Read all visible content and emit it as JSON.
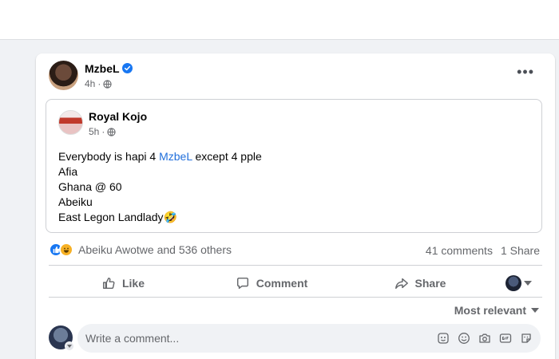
{
  "post": {
    "author": "MzbeL",
    "time": "4h",
    "meta_sep": "·",
    "shared": {
      "author": "Royal Kojo",
      "time": "5h",
      "meta_sep": "·",
      "line1_pre": "Everybody is hapi 4 ",
      "line1_mention": "MzbeL",
      "line1_post": " except 4 pple",
      "line2": "Afia",
      "line3": "Ghana @ 60",
      "line4": "Abeiku",
      "line5": "East Legon Landlady🤣"
    },
    "reactions_text": "Abeiku Awotwe and 536 others",
    "comments_count": "41 comments",
    "shares_count": "1 Share",
    "actions": {
      "like": "Like",
      "comment": "Comment",
      "share": "Share"
    },
    "sort_label": "Most relevant",
    "comment_placeholder": "Write a comment...",
    "more_label": "•••"
  },
  "colors": {
    "accent": "#1877f2",
    "mention": "#216fdb",
    "muted": "#65676b",
    "background": "#f0f2f5"
  },
  "icons": [
    "verified-badge-icon",
    "globe-icon",
    "more-icon",
    "like-reaction-icon",
    "haha-reaction-icon",
    "like-icon",
    "comment-icon",
    "share-icon",
    "chevron-down-icon",
    "sticker-icon",
    "emoji-icon",
    "camera-icon",
    "gif-icon",
    "avatar-sticker-icon"
  ]
}
